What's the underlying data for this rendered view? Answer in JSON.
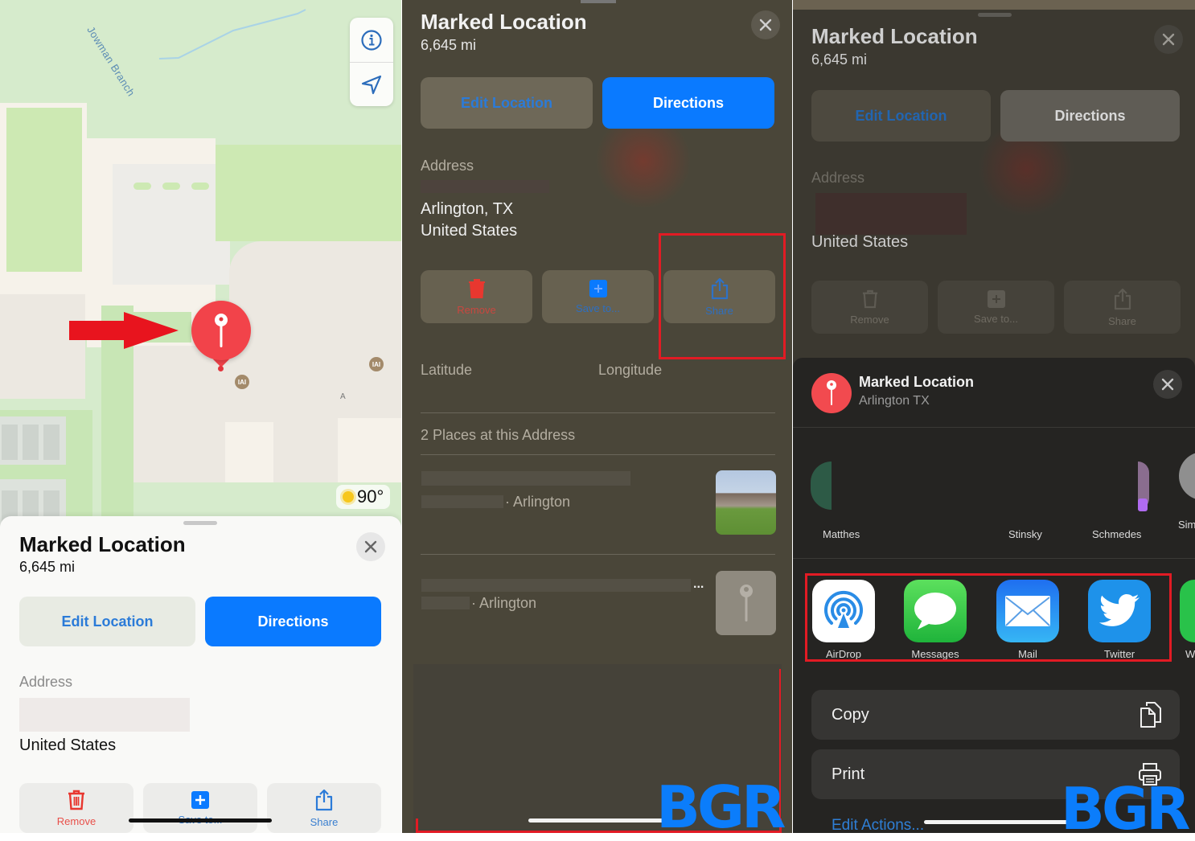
{
  "colors": {
    "accent_blue": "#0a7aff",
    "pin_red": "#f2434a",
    "highlight_red": "#e21b24",
    "watermark_blue": "#0b7dfb"
  },
  "panel1": {
    "map": {
      "water_label": "Jowman Branch",
      "info_button": "info-icon",
      "location_button": "location-arrow-icon",
      "weather": {
        "icon": "sun-icon",
        "temperature": "90°"
      },
      "poi_marker_label": "A"
    },
    "sheet": {
      "title": "Marked Location",
      "distance": "6,645 mi",
      "edit_location": "Edit Location",
      "directions": "Directions",
      "address_label": "Address",
      "address_country": "United States",
      "actions": [
        {
          "label": "Remove",
          "icon": "trash-icon"
        },
        {
          "label": "Save to...",
          "icon": "plus-square-icon"
        },
        {
          "label": "Share",
          "icon": "share-icon"
        }
      ]
    }
  },
  "panel2": {
    "title": "Marked Location",
    "distance": "6,645 mi",
    "edit_location": "Edit Location",
    "directions": "Directions",
    "address_label": "Address",
    "address_line2": "Arlington, TX",
    "address_country": "United States",
    "actions": [
      {
        "label": "Remove",
        "icon": "trash-icon"
      },
      {
        "label": "Save to...",
        "icon": "plus-square-icon"
      },
      {
        "label": "Share",
        "icon": "share-icon"
      }
    ],
    "latitude_label": "Latitude",
    "longitude_label": "Longitude",
    "places_header": "2 Places at this Address",
    "places": [
      {
        "subtitle": "· Arlington",
        "thumb": "school-photo"
      },
      {
        "subtitle": "· Arlington",
        "thumb": "pin-placeholder",
        "more": "..."
      }
    ],
    "watermark": "BGR"
  },
  "panel3": {
    "title": "Marked Location",
    "distance": "6,645 mi",
    "edit_location": "Edit Location",
    "directions": "Directions",
    "address_label": "Address",
    "address_country": "United States",
    "actions": [
      {
        "label": "Remove",
        "icon": "trash-icon"
      },
      {
        "label": "Save to...",
        "icon": "plus-square-icon"
      },
      {
        "label": "Share",
        "icon": "share-icon"
      }
    ],
    "share_sheet": {
      "title": "Marked Location",
      "subtitle": "Arlington TX",
      "contacts": [
        {
          "name": "Matthes"
        },
        {
          "name": "Stinsky"
        },
        {
          "name": "Schmedes"
        },
        {
          "name": "Sim"
        }
      ],
      "apps": [
        {
          "label": "AirDrop",
          "icon": "airdrop-icon"
        },
        {
          "label": "Messages",
          "icon": "messages-icon"
        },
        {
          "label": "Mail",
          "icon": "mail-icon"
        },
        {
          "label": "Twitter",
          "icon": "twitter-icon"
        },
        {
          "label": "W",
          "icon": "whatsapp-icon"
        }
      ],
      "list_actions": [
        {
          "label": "Copy",
          "icon": "copy-icon"
        },
        {
          "label": "Print",
          "icon": "printer-icon"
        }
      ],
      "edit_actions": "Edit Actions..."
    },
    "watermark": "BGR"
  }
}
